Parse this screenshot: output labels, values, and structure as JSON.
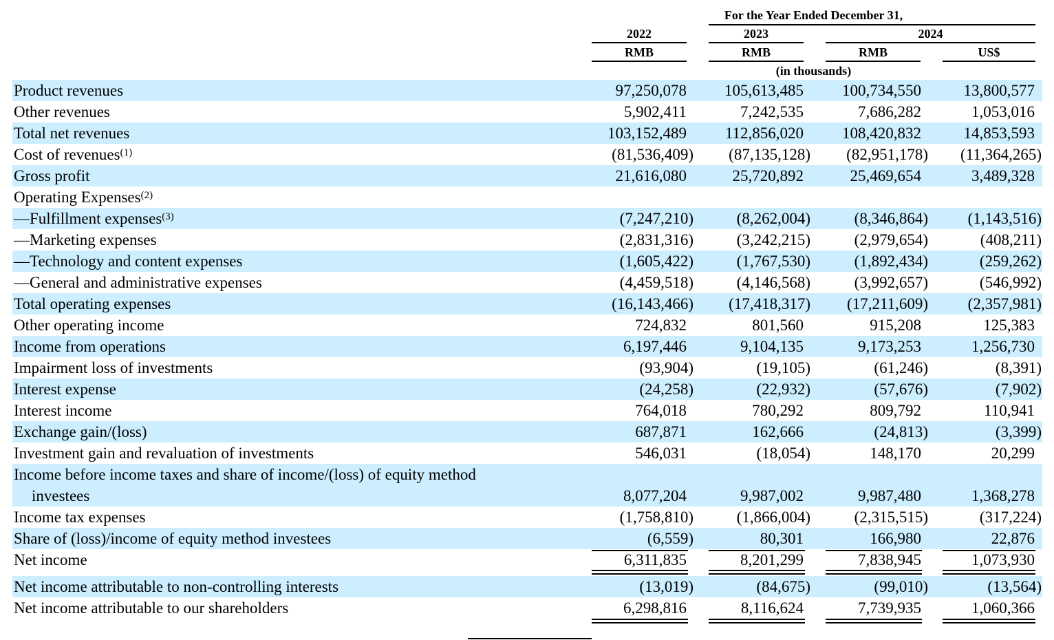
{
  "header": {
    "period_title": "For the Year Ended December 31,",
    "years": [
      "2022",
      "2023",
      "2024"
    ],
    "currencies": [
      "RMB",
      "RMB",
      "RMB",
      "US$"
    ],
    "units_note": "(in thousands)"
  },
  "rows": [
    {
      "label": "Product revenues",
      "values": [
        "97,250,078",
        "105,613,485",
        "100,734,550",
        "13,800,577"
      ]
    },
    {
      "label": "Other revenues",
      "values": [
        "5,902,411",
        "7,242,535",
        "7,686,282",
        "1,053,016"
      ]
    },
    {
      "label": "Total net revenues",
      "values": [
        "103,152,489",
        "112,856,020",
        "108,420,832",
        "14,853,593"
      ]
    },
    {
      "label": "Cost of revenues",
      "note": "(1)",
      "values": [
        "(81,536,409)",
        "(87,135,128)",
        "(82,951,178)",
        "(11,364,265)"
      ]
    },
    {
      "label": "Gross profit",
      "values": [
        "21,616,080",
        "25,720,892",
        "25,469,654",
        "3,489,328"
      ]
    },
    {
      "label": "Operating Expenses",
      "note": "(2)",
      "values": [
        "",
        "",
        "",
        ""
      ]
    },
    {
      "label": "—Fulfillment expenses",
      "note": "(3)",
      "values": [
        "(7,247,210)",
        "(8,262,004)",
        "(8,346,864)",
        "(1,143,516)"
      ]
    },
    {
      "label": "—Marketing expenses",
      "values": [
        "(2,831,316)",
        "(3,242,215)",
        "(2,979,654)",
        "(408,211)"
      ]
    },
    {
      "label": "—Technology and content expenses",
      "values": [
        "(1,605,422)",
        "(1,767,530)",
        "(1,892,434)",
        "(259,262)"
      ]
    },
    {
      "label": "—General and administrative expenses",
      "values": [
        "(4,459,518)",
        "(4,146,568)",
        "(3,992,657)",
        "(546,992)"
      ]
    },
    {
      "label": "Total operating expenses",
      "values": [
        "(16,143,466)",
        "(17,418,317)",
        "(17,211,609)",
        "(2,357,981)"
      ]
    },
    {
      "label": "Other operating income",
      "values": [
        "724,832",
        "801,560",
        "915,208",
        "125,383"
      ]
    },
    {
      "label": "Income from operations",
      "values": [
        "6,197,446",
        "9,104,135",
        "9,173,253",
        "1,256,730"
      ]
    },
    {
      "label": "Impairment loss of investments",
      "values": [
        "(93,904)",
        "(19,105)",
        "(61,246)",
        "(8,391)"
      ]
    },
    {
      "label": "Interest expense",
      "values": [
        "(24,258)",
        "(22,932)",
        "(57,676)",
        "(7,902)"
      ]
    },
    {
      "label": "Interest income",
      "values": [
        "764,018",
        "780,292",
        "809,792",
        "110,941"
      ]
    },
    {
      "label": "Exchange gain/(loss)",
      "values": [
        "687,871",
        "162,666",
        "(24,813)",
        "(3,399)"
      ]
    },
    {
      "label": "Investment gain and revaluation of investments",
      "values": [
        "546,031",
        "(18,054)",
        "148,170",
        "20,299"
      ]
    },
    {
      "label": "Income before income taxes and share of income/(loss) of equity method",
      "label_line2": "investees",
      "values": [
        "8,077,204",
        "9,987,002",
        "9,987,480",
        "1,368,278"
      ]
    },
    {
      "label": "Income tax expenses",
      "values": [
        "(1,758,810)",
        "(1,866,004)",
        "(2,315,515)",
        "(317,224)"
      ]
    },
    {
      "label": "Share of (loss)/income of equity method investees",
      "values": [
        "(6,559)",
        "80,301",
        "166,980",
        "22,876"
      ]
    },
    {
      "label": "Net income",
      "values": [
        "6,311,835",
        "8,201,299",
        "7,838,945",
        "1,073,930"
      ]
    },
    {
      "label": "Net income attributable to non-controlling interests",
      "values": [
        "(13,019)",
        "(84,675)",
        "(99,010)",
        "(13,564)"
      ]
    },
    {
      "label": "Net income attributable to our shareholders",
      "values": [
        "6,298,816",
        "8,116,624",
        "7,739,935",
        "1,060,366"
      ]
    }
  ]
}
